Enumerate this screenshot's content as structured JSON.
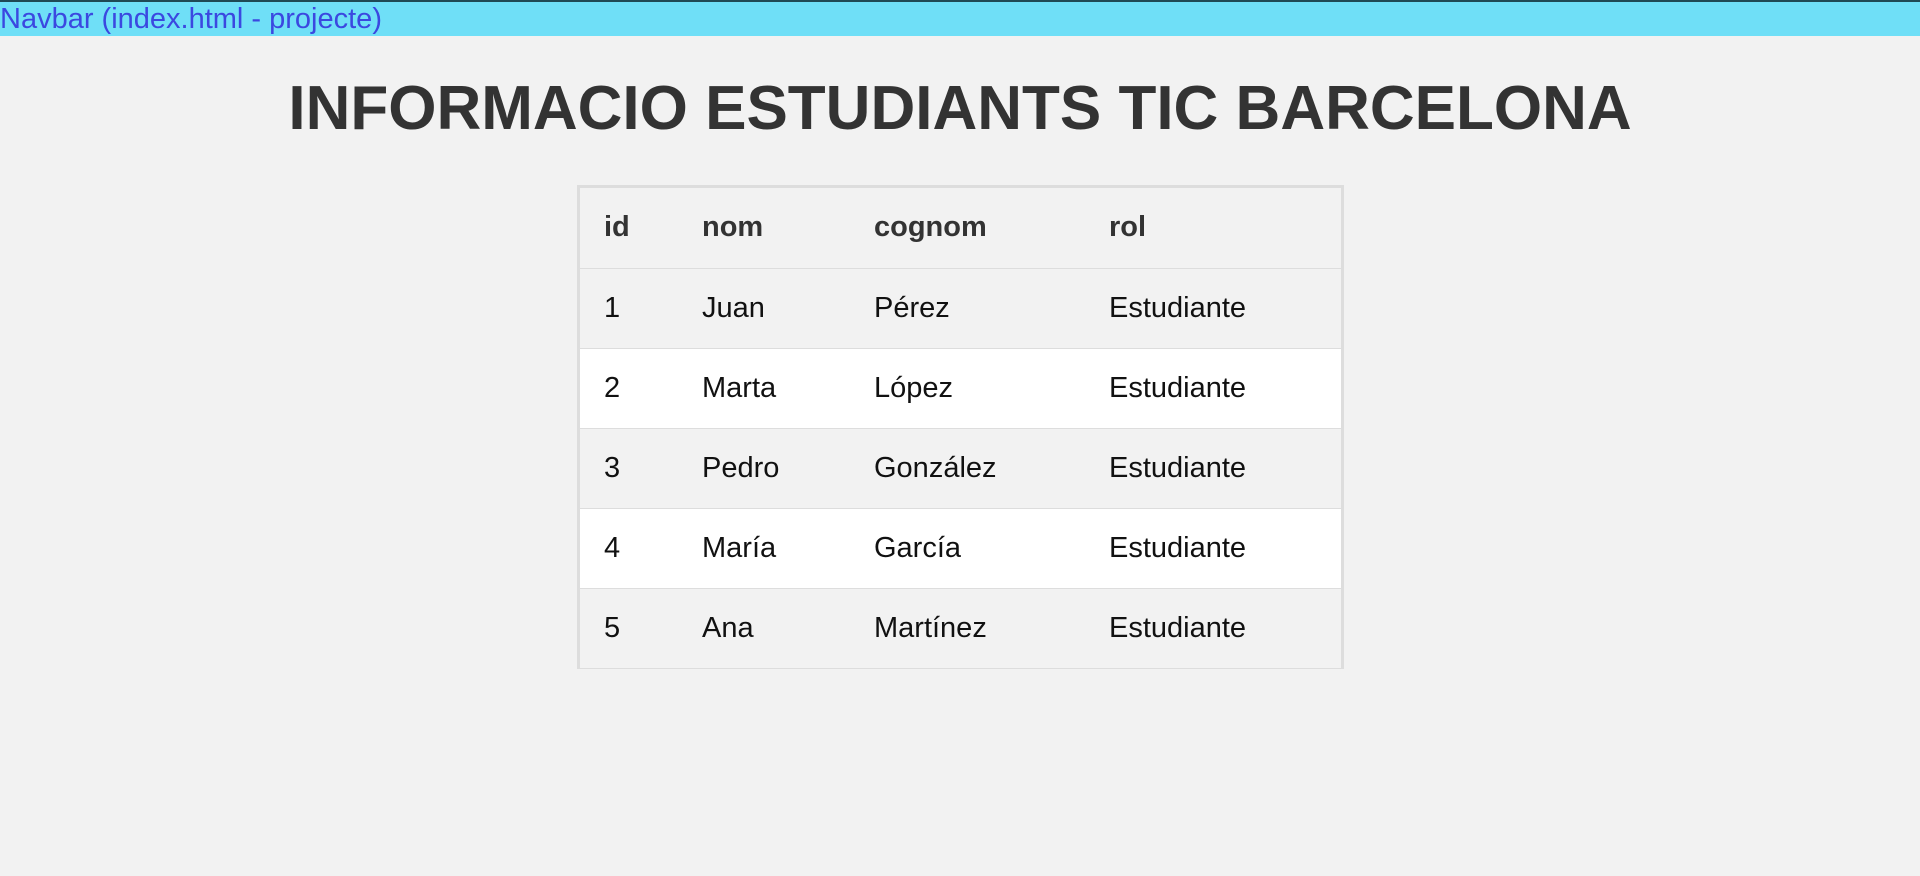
{
  "navbar": {
    "link_text": "Navbar (index.html - projecte)"
  },
  "page": {
    "title": "INFORMACIO ESTUDIANTS TIC BARCELONA"
  },
  "table": {
    "headers": [
      "id",
      "nom",
      "cognom",
      "rol"
    ],
    "rows": [
      [
        "1",
        "Juan",
        "Pérez",
        "Estudiante"
      ],
      [
        "2",
        "Marta",
        "López",
        "Estudiante"
      ],
      [
        "3",
        "Pedro",
        "González",
        "Estudiante"
      ],
      [
        "4",
        "María",
        "García",
        "Estudiante"
      ],
      [
        "5",
        "Ana",
        "Martínez",
        "Estudiante"
      ]
    ]
  },
  "colors": {
    "navbar_bg": "#6fdff7",
    "navbar_link": "#3b48e0",
    "page_bg": "#f2f2f2",
    "title": "#333333",
    "row_alt": "#ffffff"
  }
}
